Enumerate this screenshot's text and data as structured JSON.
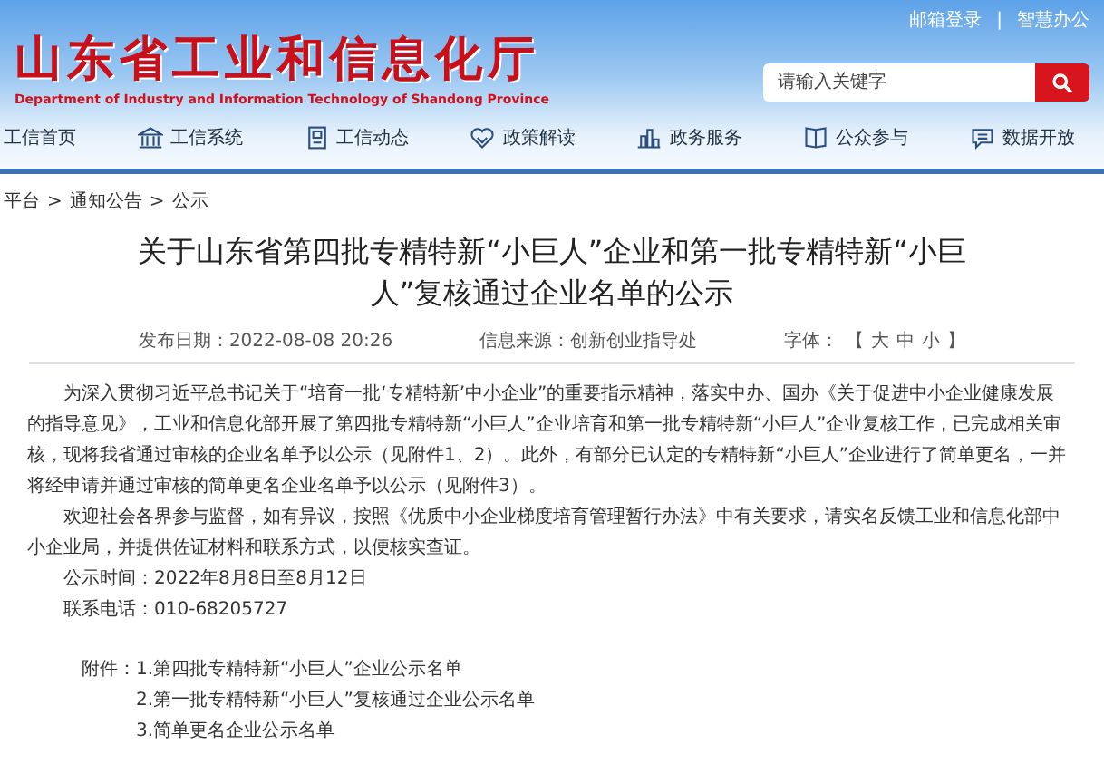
{
  "header": {
    "site_title": "山东省工业和信息化厅",
    "site_subtitle": "Department of Industry and Information Technology of Shandong Province",
    "top_links": [
      "邮箱登录",
      "智慧办公"
    ],
    "top_links_separator": "|",
    "search": {
      "placeholder": "请输入关键字"
    }
  },
  "nav": [
    {
      "label": "工信首页"
    },
    {
      "label": "工信系统"
    },
    {
      "label": "工信动态"
    },
    {
      "label": "政策解读"
    },
    {
      "label": "政务服务"
    },
    {
      "label": "公众参与"
    },
    {
      "label": "数据开放"
    }
  ],
  "breadcrumb": [
    "平台",
    "通知公告",
    "公示"
  ],
  "breadcrumb_separator": ">",
  "article": {
    "title": "关于山东省第四批专精特新“小巨人”企业和第一批专精特新“小巨人”复核通过企业名单的公示",
    "meta": {
      "date": "发布日期：2022-08-08 20:26",
      "source": "信息来源：创新创业指导处",
      "font_label": "字体：",
      "open_bracket": "【",
      "font_sizes": [
        "大",
        "中",
        "小"
      ],
      "close_bracket": "】"
    },
    "paragraphs": [
      "为深入贯彻习近平总书记关于“培育一批‘专精特新’中小企业”的重要指示精神，落实中办、国办《关于促进中小企业健康发展的指导意见》，工业和信息化部开展了第四批专精特新“小巨人”企业培育和第一批专精特新“小巨人”企业复核工作，已完成相关审核，现将我省通过审核的企业名单予以公示（见附件1、2）。此外，有部分已认定的专精特新“小巨人”企业进行了简单更名，一并将经申请并通过审核的简单更名企业名单予以公示（见附件3）。",
      "欢迎社会各界参与监督，如有异议，按照《优质中小企业梯度培育管理暂行办法》中有关要求，请实名反馈工业和信息化部中小企业局，并提供佐证材料和联系方式，以便核实查证。",
      "公示时间：2022年8月8日至8月12日",
      "联系电话：010-68205727"
    ],
    "attachments_label": "附件：",
    "attachments": [
      "1.第四批专精特新“小巨人”企业公示名单",
      "2.第一批专精特新“小巨人”复核通过企业公示名单",
      "3.简单更名企业公示名单"
    ]
  }
}
